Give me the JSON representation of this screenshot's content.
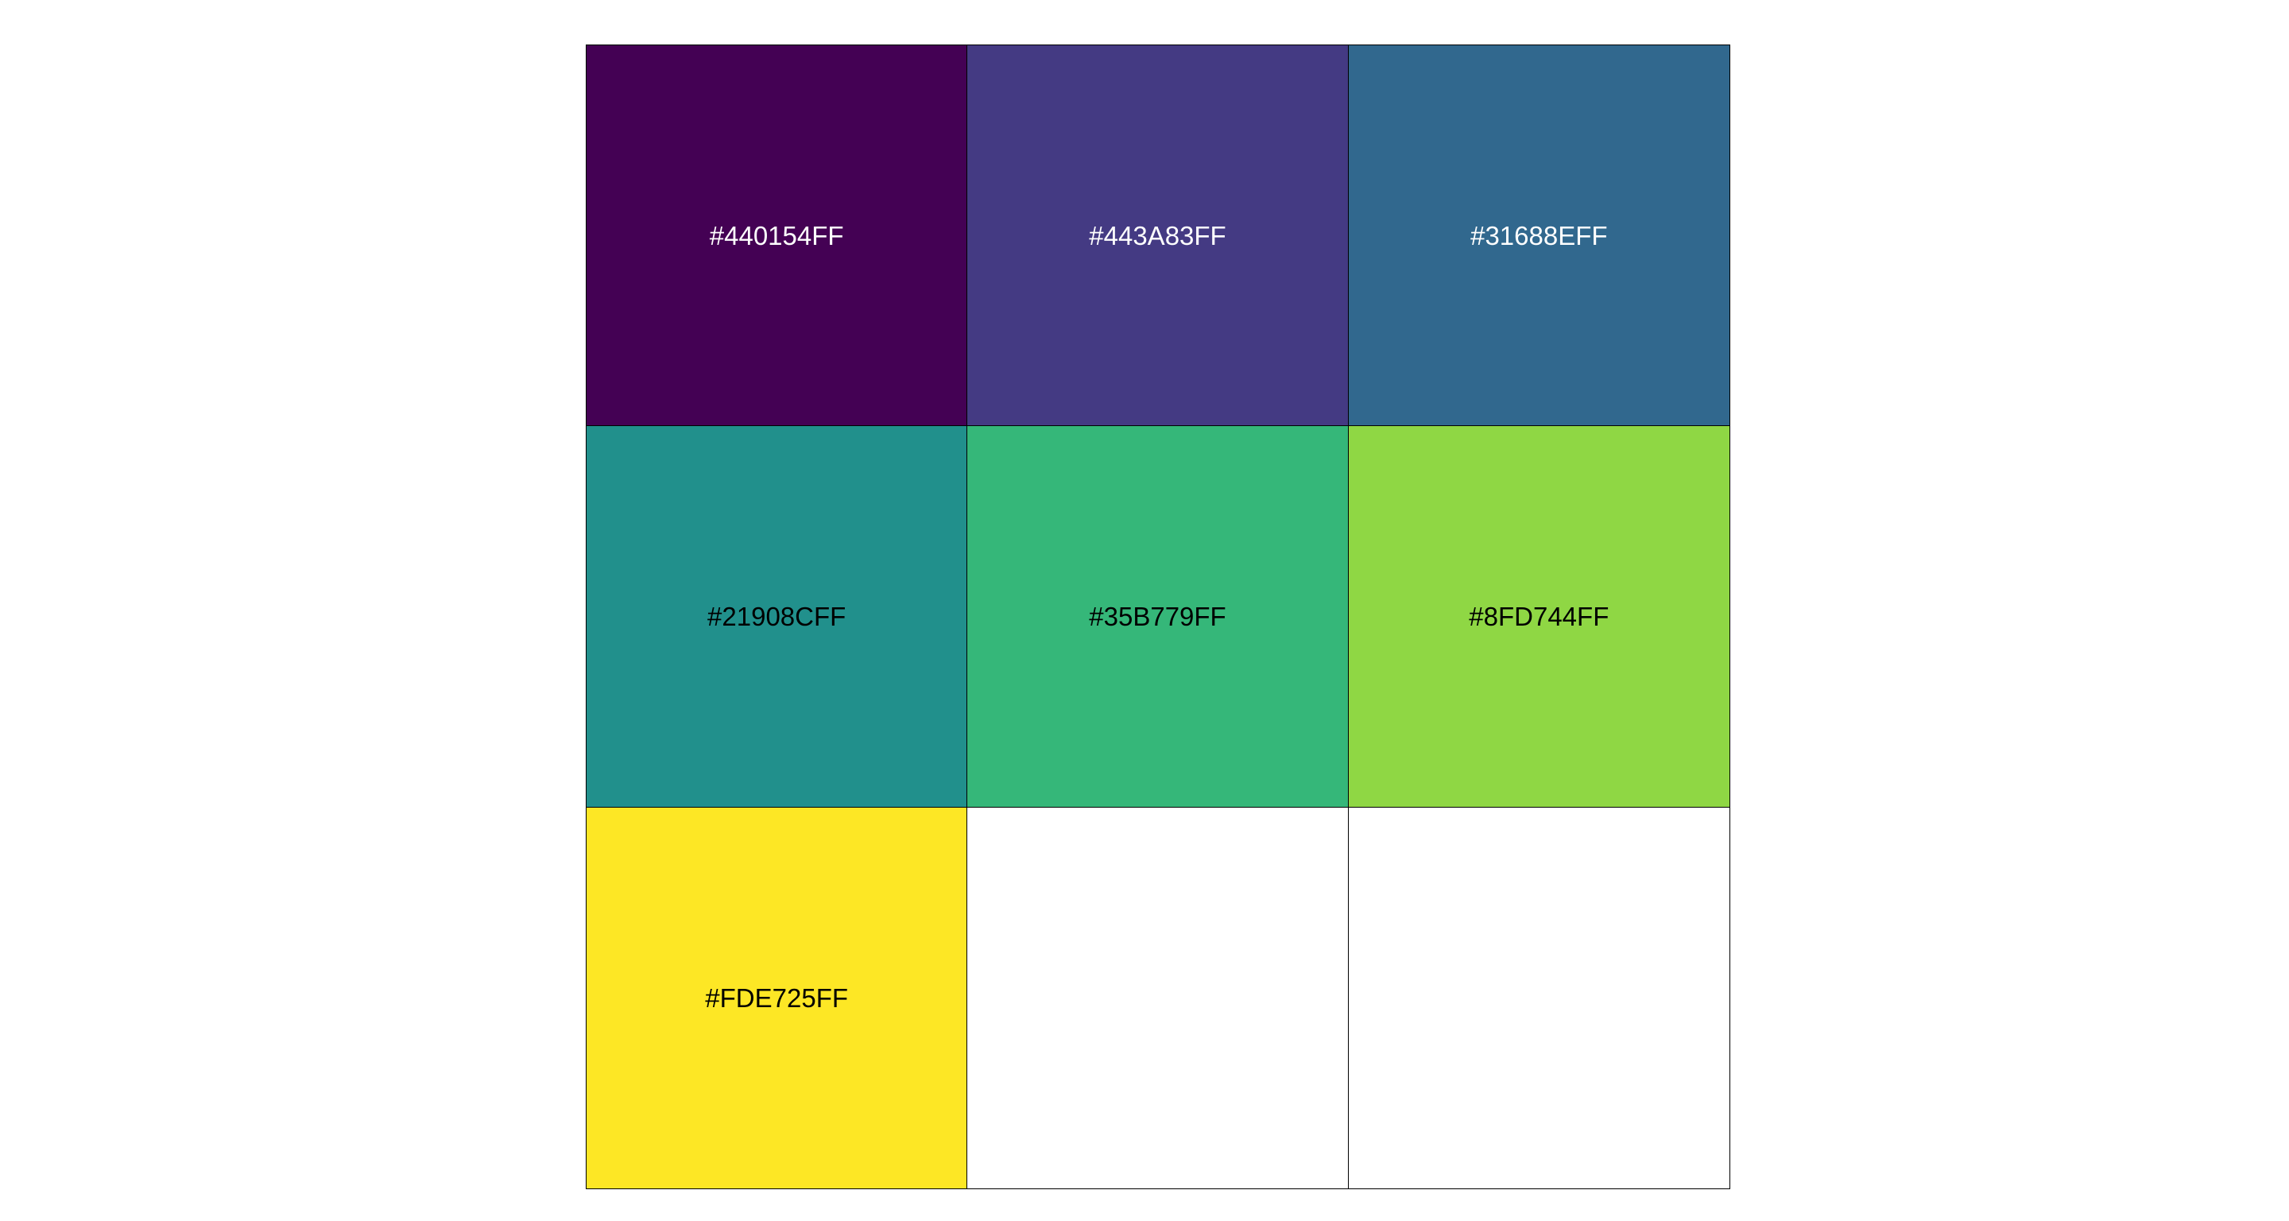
{
  "palette": {
    "swatches": [
      {
        "label": "#440154FF",
        "color": "#440154",
        "text_color": "#ffffff"
      },
      {
        "label": "#443A83FF",
        "color": "#443A83",
        "text_color": "#ffffff"
      },
      {
        "label": "#31688EFF",
        "color": "#31688E",
        "text_color": "#ffffff"
      },
      {
        "label": "#21908CFF",
        "color": "#21908C",
        "text_color": "#000000"
      },
      {
        "label": "#35B779FF",
        "color": "#35B779",
        "text_color": "#000000"
      },
      {
        "label": "#8FD744FF",
        "color": "#8FD744",
        "text_color": "#000000"
      },
      {
        "label": "#FDE725FF",
        "color": "#FDE725",
        "text_color": "#000000"
      }
    ],
    "empty_cell_color": "#ffffff",
    "border_color": "#000000"
  }
}
